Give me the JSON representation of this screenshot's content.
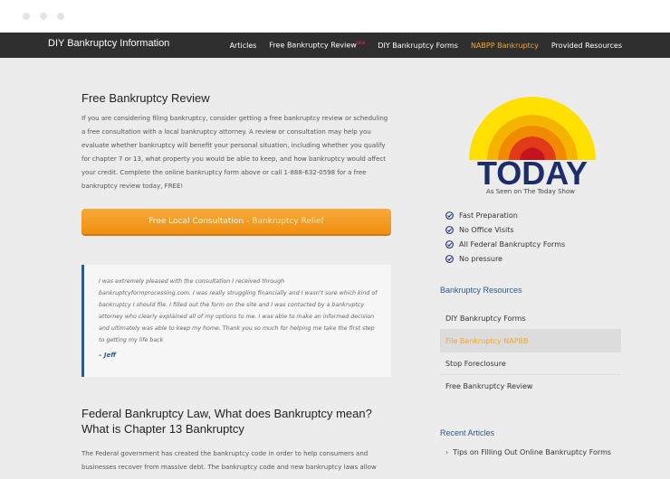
{
  "nav": {
    "brand": "DIY Bankruptcy Information",
    "items": [
      "Articles",
      "Free Bankruptcy Review",
      "DIY Bankruptcy Forms",
      "NABPP Bankruptcy",
      "Provided Resources"
    ],
    "new_badge": "NEW"
  },
  "main": {
    "title": "Free Bankruptcy Review",
    "intro": "If you are considering filing bankruptcy, consider getting a free bankruptcy review or scheduling a free consultation with a local bankruptcy attorney. A review or consultation may help you evaluate whether bankruptcy will benefit your personal situation, including whether you qualify for chapter 7 or 13, what property you would be able to keep, and how bankruptcy would affect your credit. Complete the online bankruptcy form above or call 1-888-632-0598 for a free bankruptcy review today, FREE!",
    "cta_main": "Free Local Consultation",
    "cta_sub": "- Bankruptcy Relief",
    "quote": "I was extremely pleased with the consultation I received through bankruptcyformprocessing.com. I was really struggling financially and I wasn't sure which kind of bankruptcy I should file. I filled out the form on the site and I was contacted by a bankruptcy attorney who clearly explained all of my options to me. I was able to make an informed decision and ultimately was able to keep my home. Thank you so much for helping me take the first step to getting my life back",
    "author": "– Jeff",
    "title2": "Federal Bankruptcy Law, What does Bankruptcy mean? What is Chapter 13 Bankruptcy",
    "para2": "The Federal government has created the bankruptcy code in order to help consumers and businesses recover from massive debt. The bankruptcy code and new bankruptcy laws allow"
  },
  "sidebar": {
    "logo_text": "TODAY",
    "seen_on": "As Seen on The Today Show",
    "features": [
      "Fast Preparation",
      "No Office Visits",
      "All Federal Bankruptcy Forms",
      "No pressure"
    ],
    "resources_title": "Bankruptcy Resources",
    "resources": [
      "DIY Bankruptcy Forms",
      "File Bankruptcy NAPBB",
      "Stop Foreclosure",
      "Free Bankruptcy Review"
    ],
    "recent_title": "Recent Articles",
    "recent": [
      "Tips on Filling Out Online Bankruptcy Forms"
    ]
  }
}
